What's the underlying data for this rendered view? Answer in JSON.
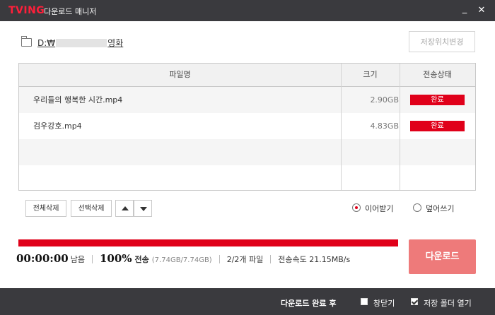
{
  "titlebar": {
    "brand": "TVING",
    "title": "다운로드 매니저",
    "minimize_glyph": "_",
    "close_glyph": "✕"
  },
  "path": {
    "prefix": "D:₩",
    "suffix": "영화",
    "change_label": "저장위치변경"
  },
  "table": {
    "headers": [
      "파일명",
      "크기",
      "전송상태"
    ],
    "rows": [
      {
        "name": "우리들의 행복한 시간.mp4",
        "size": "2.90GB",
        "status": "완료"
      },
      {
        "name": "검우강호.mp4",
        "size": "4.83GB",
        "status": "완료"
      }
    ]
  },
  "controls": {
    "delete_all": "전체삭제",
    "delete_selected": "선택삭제",
    "resume_label": "이어받기",
    "overwrite_label": "덮어쓰기",
    "selected_mode": "resume"
  },
  "status": {
    "remaining_time": "00:00:00",
    "remaining_label": "남음",
    "percent": "100%",
    "transfer_label": "전송",
    "transfer_amount": "(7.74GB/7.74GB)",
    "file_count": "2/2개 파일",
    "speed": "전송속도 21.15MB/s",
    "progress_fraction": 1.0
  },
  "download_button": "다운로드",
  "footer": {
    "after_label": "다운로드 완료 후",
    "close_window": "창닫기",
    "close_window_checked": false,
    "open_folder": "저장 폴더 열기",
    "open_folder_checked": true
  },
  "colors": {
    "accent": "#e0001a",
    "brand": "#ff1f3a",
    "dark_bar": "#3a3a3e",
    "download_button": "#ee7a7a"
  }
}
